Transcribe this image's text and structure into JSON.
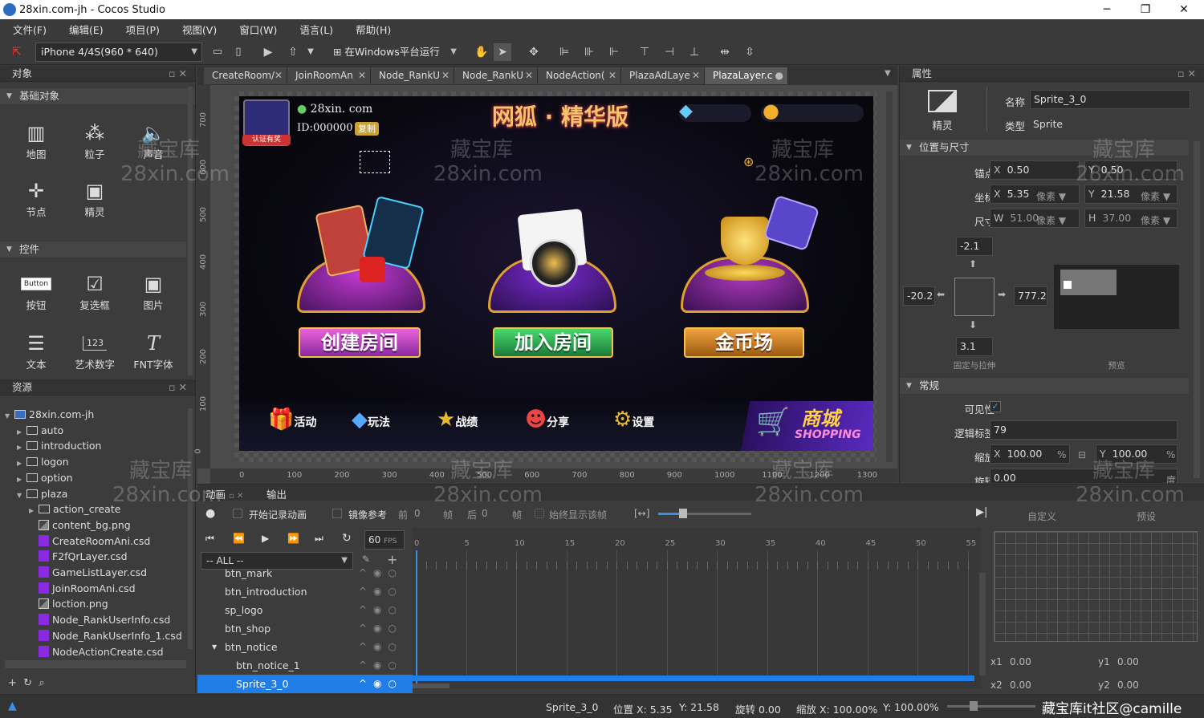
{
  "window": {
    "title": "28xin.com-jh - Cocos Studio",
    "controls": [
      "─",
      "❐",
      "✕"
    ]
  },
  "menu": [
    "文件(F)",
    "编辑(E)",
    "项目(P)",
    "视图(V)",
    "窗口(W)",
    "语言(L)",
    "帮助(H)"
  ],
  "toolbar": {
    "device": "iPhone 4/4S(960 * 640)",
    "run_label": "在Windows平台运行"
  },
  "objects_panel": {
    "title": "对象",
    "basic_section": "基础对象",
    "basic_items": [
      {
        "label": "地图",
        "icon": "map-icon"
      },
      {
        "label": "粒子",
        "icon": "particle-icon"
      },
      {
        "label": "声音",
        "icon": "sound-icon"
      },
      {
        "label": "节点",
        "icon": "node-icon"
      },
      {
        "label": "精灵",
        "icon": "sprite-icon"
      }
    ],
    "control_section": "控件",
    "control_items": [
      {
        "label": "按钮",
        "icon": "button-icon"
      },
      {
        "label": "复选框",
        "icon": "checkbox-icon"
      },
      {
        "label": "图片",
        "icon": "image-icon"
      },
      {
        "label": "文本",
        "icon": "text-icon"
      },
      {
        "label": "艺术数字",
        "icon": "atlas-number-icon"
      },
      {
        "label": "FNT字体",
        "icon": "fnt-font-icon"
      }
    ],
    "button_glyph": "Button",
    "artnum_glyph": "123"
  },
  "resources_panel": {
    "title": "资源",
    "items": [
      {
        "label": "28xin.com-jh",
        "type": "project",
        "level": 0,
        "expanded": true
      },
      {
        "label": "auto",
        "type": "folder",
        "level": 1,
        "expanded": false
      },
      {
        "label": "introduction",
        "type": "folder",
        "level": 1,
        "expanded": false
      },
      {
        "label": "logon",
        "type": "folder",
        "level": 1,
        "expanded": false
      },
      {
        "label": "option",
        "type": "folder",
        "level": 1,
        "expanded": false
      },
      {
        "label": "plaza",
        "type": "folder",
        "level": 1,
        "expanded": true
      },
      {
        "label": "action_create",
        "type": "folder",
        "level": 2,
        "expanded": false
      },
      {
        "label": "content_bg.png",
        "type": "png",
        "level": 2
      },
      {
        "label": "CreateRoomAni.csd",
        "type": "csd",
        "level": 2
      },
      {
        "label": "F2fQrLayer.csd",
        "type": "csd",
        "level": 2
      },
      {
        "label": "GameListLayer.csd",
        "type": "csd",
        "level": 2
      },
      {
        "label": "JoinRoomAni.csd",
        "type": "csd",
        "level": 2
      },
      {
        "label": "loction.png",
        "type": "png",
        "level": 2
      },
      {
        "label": "Node_RankUserInfo.csd",
        "type": "csd",
        "level": 2
      },
      {
        "label": "Node_RankUserInfo_1.csd",
        "type": "csd",
        "level": 2
      },
      {
        "label": "NodeActionCreate.csd",
        "type": "csd",
        "level": 2
      }
    ]
  },
  "tabs": [
    {
      "label": "CreateRoom/",
      "active": false
    },
    {
      "label": "JoinRoomAn",
      "active": false
    },
    {
      "label": "Node_RankU",
      "active": false
    },
    {
      "label": "Node_RankU",
      "active": false
    },
    {
      "label": "NodeAction(",
      "active": false
    },
    {
      "label": "PlazaAdLaye",
      "active": false
    },
    {
      "label": "PlazaLayer.c",
      "active": true
    }
  ],
  "canvas": {
    "hruler": [
      "0",
      "100",
      "200",
      "300",
      "400",
      "500",
      "600",
      "700",
      "800",
      "900",
      "1000",
      "1100",
      "1200",
      "1300"
    ],
    "vruler": [
      "700",
      "600",
      "500",
      "400",
      "300",
      "200",
      "100",
      "0"
    ],
    "game": {
      "site": "28xin. com",
      "id": "ID:000000",
      "copy": "复制",
      "verify": "认证有奖",
      "title": "网狐 · 精华版",
      "create_room": "创建房间",
      "join_room": "加入房间",
      "gold_field": "金币场",
      "bottom_nav": [
        "活动",
        "玩法",
        "战绩",
        "分享",
        "设置"
      ],
      "shop": "商城",
      "shop_en": "SHOPPING"
    }
  },
  "properties_panel": {
    "title": "属性",
    "sprite_label": "精灵",
    "name_label": "名称",
    "name_value": "Sprite_3_0",
    "type_label": "类型",
    "type_value": "Sprite",
    "pos_section": "位置与尺寸",
    "anchor_label": "锚点",
    "anchor_x": "0.50",
    "anchor_y": "0.50",
    "pos_label": "坐标",
    "pos_x": "5.35",
    "pos_y": "21.58",
    "unit_px": "像素",
    "size_label": "尺寸",
    "size_w": "51.00",
    "size_h": "37.00",
    "margin_top": "-2.1",
    "margin_left": "-20.2",
    "margin_right": "777.2",
    "margin_bottom": "3.1",
    "fix_stretch": "固定与拉伸",
    "preview": "预览",
    "general_section": "常规",
    "visible_label": "可见性",
    "tag_label": "逻辑标签",
    "tag_value": "79",
    "scale_label": "缩放",
    "scale_x": "100.00",
    "scale_y": "100.00",
    "rotation_label": "旋转",
    "rotation_value": "0.00",
    "unit_pct": "%",
    "unit_deg": "度"
  },
  "animation_panel": {
    "tab_anim": "动画",
    "tab_output": "输出",
    "record": "开始记录动画",
    "mirror": "镜像参考",
    "prev_label": "前",
    "prev_value": "0",
    "frame_label": "帧",
    "next_label": "后",
    "next_value": "0",
    "always_show": "始终显示该帧",
    "fps_value": "60",
    "fps_label": "FPS",
    "filter": "-- ALL --",
    "ticks": [
      "0",
      "5",
      "10",
      "15",
      "20",
      "25",
      "30",
      "35",
      "40",
      "45",
      "50",
      "55"
    ],
    "nodes": [
      {
        "label": "btn_mark",
        "level": 0
      },
      {
        "label": "btn_introduction",
        "level": 0
      },
      {
        "label": "sp_logo",
        "level": 0
      },
      {
        "label": "btn_shop",
        "level": 0
      },
      {
        "label": "btn_notice",
        "level": 0,
        "expanded": true
      },
      {
        "label": "btn_notice_1",
        "level": 1
      },
      {
        "label": "Sprite_3_0",
        "level": 1,
        "selected": true
      }
    ],
    "custom": "自定义",
    "preset": "预设",
    "x1_label": "x1",
    "x1_value": "0.00",
    "y1_label": "y1",
    "y1_value": "0.00",
    "x2_label": "x2",
    "x2_value": "0.00",
    "y2_label": "y2",
    "y2_value": "0.00"
  },
  "statusbar": {
    "node": "Sprite_3_0",
    "pos": "位置 X: 5.35",
    "pos_y": "Y: 21.58",
    "rotation": "旋转 0.00",
    "scale_x": "缩放 X: 100.00%",
    "scale_y": "Y: 100.00%",
    "brand": "藏宝库it社区@camille"
  },
  "watermark": {
    "cn": "藏宝库",
    "en": "28xin.com"
  }
}
